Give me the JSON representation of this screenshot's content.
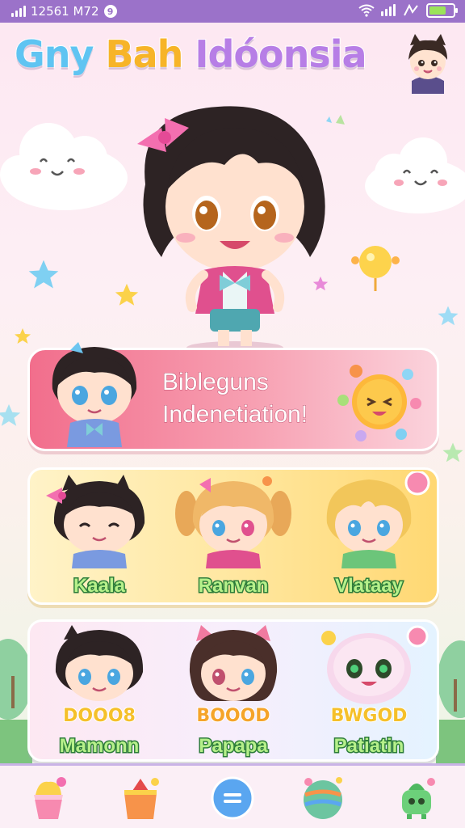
{
  "status_bar": {
    "time_text": "12561 M72",
    "notification_badge": "9",
    "battery_level": 0.75,
    "icons": [
      "signal-bars-icon",
      "wifi-icon",
      "signal-icon",
      "network-icon",
      "battery-icon"
    ]
  },
  "header": {
    "title_parts": [
      "Gny",
      "Bah",
      "Idóonsia"
    ],
    "title_colors": [
      "#5fc4f2",
      "#f7b428",
      "#b77ee6"
    ],
    "avatar_icon": "cat-ear-boy-avatar-icon"
  },
  "banner": {
    "line1": "Bibleguns",
    "line2": "Indenetiation!",
    "icons": [
      "chibi-boy-icon",
      "smiling-sun-icon"
    ]
  },
  "characters_row1": [
    {
      "name": "Kaala",
      "icon": "winking-girl-icon"
    },
    {
      "name": "Ranvan",
      "icon": "pigtail-girl-icon"
    },
    {
      "name": "Vlataay",
      "icon": "blonde-boy-icon"
    }
  ],
  "characters_row2": [
    {
      "name": "Mamonn",
      "badge": "DOOO8",
      "icon": "dark-hair-boy-icon"
    },
    {
      "name": "Papapa",
      "badge": "BOOOD",
      "icon": "cat-ear-girl-icon"
    },
    {
      "name": "Patiatin",
      "badge": "BWGOD",
      "icon": "green-eyed-blob-icon"
    }
  ],
  "bottom_nav": [
    {
      "icon": "ice-cream-cup-icon"
    },
    {
      "icon": "castle-basket-icon"
    },
    {
      "icon": "menu-round-icon"
    },
    {
      "icon": "planet-ball-icon"
    },
    {
      "icon": "green-robot-icon"
    }
  ],
  "colors": {
    "status_bar": "#9b72c9",
    "banner_start": "#f26e8c",
    "panel1": "#ffe7a0",
    "name_text": "#b6f08a",
    "nav_border": "#c9b3e6"
  }
}
